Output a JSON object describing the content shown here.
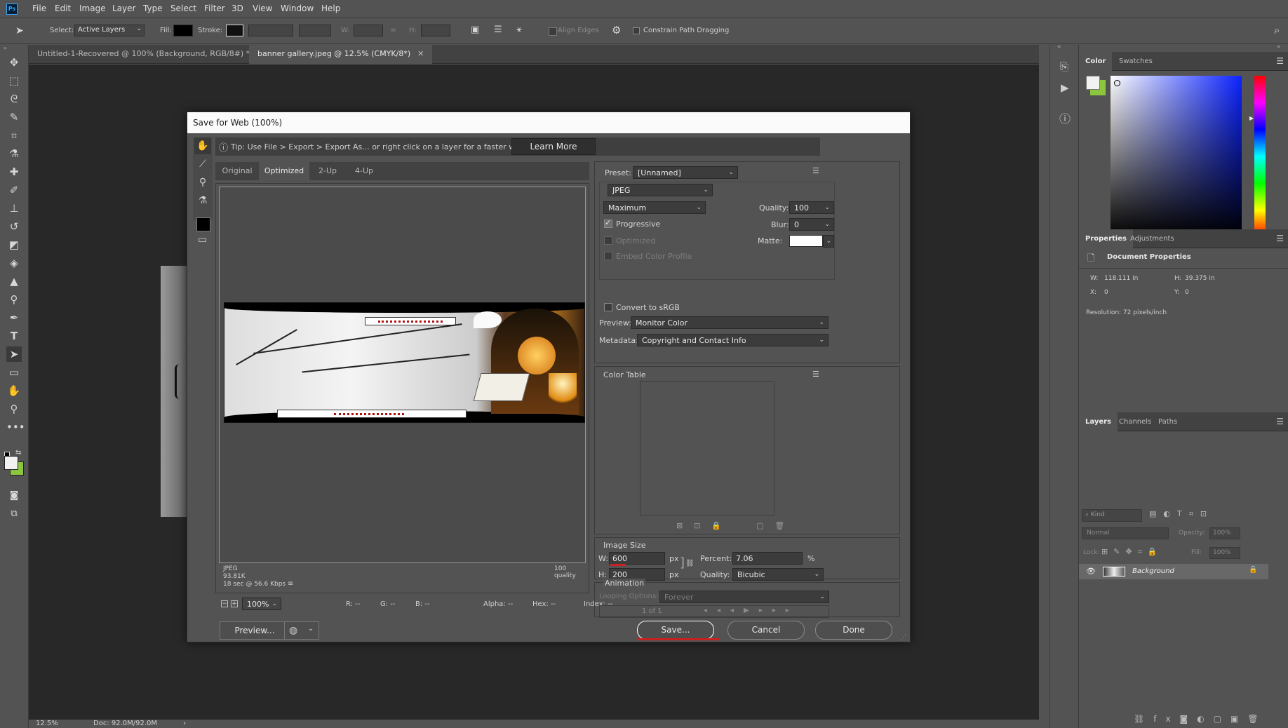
{
  "app": {
    "logo_text": "Ps"
  },
  "menu": [
    "File",
    "Edit",
    "Image",
    "Layer",
    "Type",
    "Select",
    "Filter",
    "3D",
    "View",
    "Window",
    "Help"
  ],
  "options_bar": {
    "select_label": "Select:",
    "select_value": "Active Layers",
    "fill_label": "Fill:",
    "stroke_label": "Stroke:",
    "w_label": "W:",
    "h_label": "H:",
    "align_edges": "Align Edges",
    "constrain": "Constrain Path Dragging"
  },
  "doc_tabs": [
    {
      "label": "Untitled-1-Recovered @ 100% (Background, RGB/8#) *",
      "active": false
    },
    {
      "label": "banner gallery.jpeg @ 12.5% (CMYK/8*)",
      "active": true
    }
  ],
  "status": {
    "zoom": "12.5%",
    "doc": "Doc: 92.0M/92.0M"
  },
  "panels": {
    "color_tabs": [
      "Color",
      "Swatches"
    ],
    "properties_tabs": [
      "Properties",
      "Adjustments"
    ],
    "doc_props_title": "Document Properties",
    "w_label": "W:",
    "w_value": "118.111 in",
    "h_label": "H:",
    "h_value": "39.375 in",
    "x_label": "X:",
    "x_value": "0",
    "y_label": "Y:",
    "y_value": "0",
    "resolution": "Resolution: 72 pixels/inch",
    "layers_tabs": [
      "Layers",
      "Channels",
      "Paths"
    ],
    "kind_placeholder": "Kind",
    "blend_mode": "Normal",
    "opacity_label": "Opacity:",
    "opacity_value": "100%",
    "lock_label": "Lock:",
    "fill_label": "Fill:",
    "fill_value": "100%",
    "layer_name": "Background"
  },
  "dialog": {
    "title": "Save for Web (100%)",
    "tip": "Tip: Use File > Export > Export As... or right click on a layer for a faster way to export assets",
    "learn_more": "Learn More",
    "view_tabs": [
      "Original",
      "Optimized",
      "2-Up",
      "4-Up"
    ],
    "active_view": "Optimized",
    "preview_info": {
      "format": "JPEG",
      "size": "93.81K",
      "time": "18 sec @ 56.6 Kbps",
      "quality": "100 quality"
    },
    "zoom_value": "100%",
    "readouts": {
      "r": "R: --",
      "g": "G: --",
      "b": "B: --",
      "alpha": "Alpha: --",
      "hex": "Hex: --",
      "index": "Index: --"
    },
    "preview_button": "Preview...",
    "save_button": "Save...",
    "cancel_button": "Cancel",
    "done_button": "Done",
    "preset_label": "Preset:",
    "preset_value": "[Unnamed]",
    "format_value": "JPEG",
    "compression_value": "Maximum",
    "quality_label": "Quality:",
    "quality_value": "100",
    "progressive": "Progressive",
    "blur_label": "Blur:",
    "blur_value": "0",
    "optimized": "Optimized",
    "matte_label": "Matte:",
    "embed_profile": "Embed Color Profile",
    "convert_srgb": "Convert to sRGB",
    "preview_label": "Preview:",
    "preview_value": "Monitor Color",
    "metadata_label": "Metadata:",
    "metadata_value": "Copyright and Contact Info",
    "color_table": "Color Table",
    "image_size": "Image Size",
    "w_label": "W:",
    "w_value": "600",
    "h_label": "H:",
    "h_value": "200",
    "px": "px",
    "percent_label": "Percent:",
    "percent_value": "7.06",
    "percent_unit": "%",
    "isize_quality_label": "Quality:",
    "isize_quality_value": "Bicubic",
    "animation": "Animation",
    "looping_label": "Looping Options:",
    "looping_value": "Forever",
    "frame_counter": "1 of 1"
  },
  "colors": {
    "fg": "#f2f2f2",
    "bg": "#8cc63f",
    "accent_red": "#cc1f1f"
  }
}
